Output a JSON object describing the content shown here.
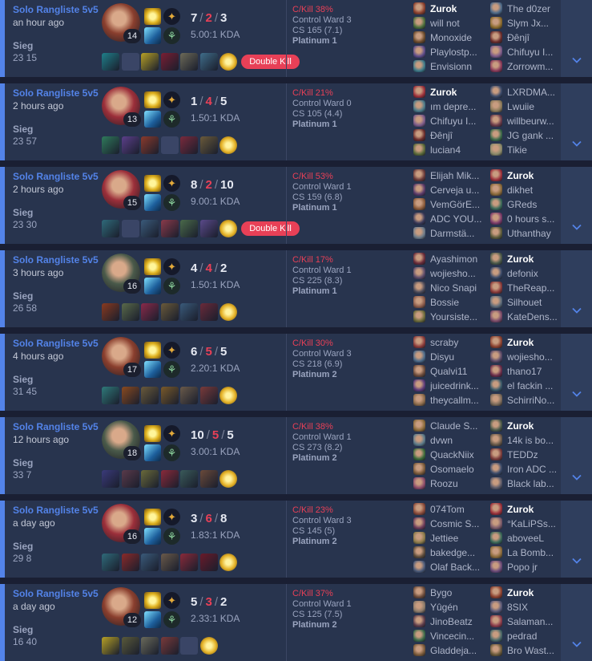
{
  "labels": {
    "double_kill": "Double Kill"
  },
  "colors": {
    "win_stripe": "#5383e8",
    "death_red": "#e84057",
    "row_bg": "#28344e"
  },
  "icons": {
    "expand": "chevron-down-icon"
  },
  "matches": [
    {
      "queue": "Solo Rangliste 5v5",
      "ago": "an hour ago",
      "result": "Sieg",
      "length": "23 15",
      "level": "14",
      "kills": "7",
      "deaths": "2",
      "assists": "3",
      "kda": "5.00:1 KDA",
      "champ_color": "#8a3f2e",
      "badge": true,
      "items": [
        "#1f7f8a",
        "",
        "#b7a126",
        "#7a1e33",
        "#6d6a58",
        "#3f6d8a",
        "gold"
      ],
      "ckill": "C/Kill 38%",
      "ward": "Control Ward 3",
      "cs": "CS 165 (7.1)",
      "tier": "Platinum 1",
      "team1": [
        {
          "name": "Zurok",
          "me": true,
          "c": "#8a3f2e"
        },
        {
          "name": "will not",
          "c": "#4a6e3c"
        },
        {
          "name": "Monoxide",
          "c": "#6a4a2c"
        },
        {
          "name": "Playlostp...",
          "c": "#5b4b8a"
        },
        {
          "name": "Envisionn",
          "c": "#3c7a8a"
        }
      ],
      "team2": [
        {
          "name": "The d0zer",
          "c": "#4d6a8a"
        },
        {
          "name": "Slym Jx...",
          "c": "#8a6a2c"
        },
        {
          "name": "Đênjî",
          "c": "#6a2c2c"
        },
        {
          "name": "Chifuyu I...",
          "c": "#7a5a8a"
        },
        {
          "name": "Zorrowm...",
          "c": "#8a3a5a"
        }
      ]
    },
    {
      "queue": "Solo Rangliste 5v5",
      "ago": "2 hours ago",
      "result": "Sieg",
      "length": "23 57",
      "level": "13",
      "kills": "1",
      "deaths": "4",
      "assists": "5",
      "kda": "1.50:1 KDA",
      "champ_color": "#9b2f3a",
      "badge": false,
      "items": [
        "#2f7a5b",
        "#5b3f8a",
        "#8a3a2c",
        "",
        "#7a2a3c",
        "#6a5a3a",
        "gold"
      ],
      "ckill": "C/Kill 21%",
      "ward": "Control Ward 0",
      "cs": "CS 105 (4.4)",
      "tier": "Platinum 1",
      "team1": [
        {
          "name": "Zurok",
          "me": true,
          "c": "#9b2f3a"
        },
        {
          "name": "ım depre...",
          "c": "#4a7a8a"
        },
        {
          "name": "Chifuyu I...",
          "c": "#7a5a8a"
        },
        {
          "name": "Đênjî",
          "c": "#6a2c2c"
        },
        {
          "name": "lucian4",
          "c": "#5a6a3a"
        }
      ],
      "team2": [
        {
          "name": "LXRDMA...",
          "c": "#3a4a6a"
        },
        {
          "name": "Lwuiie",
          "c": "#8a7a5a"
        },
        {
          "name": "willbeurw...",
          "c": "#6a3a4a"
        },
        {
          "name": "JG gank ...",
          "c": "#3a6a4a"
        },
        {
          "name": "Tikie",
          "c": "#8a8a6a"
        }
      ]
    },
    {
      "queue": "Solo Rangliste 5v5",
      "ago": "2 hours ago",
      "result": "Sieg",
      "length": "23 30",
      "level": "15",
      "kills": "8",
      "deaths": "2",
      "assists": "10",
      "kda": "9.00:1 KDA",
      "champ_color": "#9b2f3a",
      "badge": true,
      "items": [
        "#2f6a7a",
        "",
        "#3a5a7a",
        "#8a3a4a",
        "#4a6a4a",
        "#5a4a8a",
        "gold"
      ],
      "ckill": "C/Kill 53%",
      "ward": "Control Ward 1",
      "cs": "CS 159 (6.8)",
      "tier": "Platinum 1",
      "team1": [
        {
          "name": "Elijah Mik...",
          "c": "#6a3a3a"
        },
        {
          "name": "Cerveja u...",
          "c": "#5a3a6a"
        },
        {
          "name": "VemGörE...",
          "c": "#8a5a3a"
        },
        {
          "name": "ADC YOU...",
          "c": "#3a3a5a"
        },
        {
          "name": "Darmstä...",
          "c": "#6a7a8a"
        }
      ],
      "team2": [
        {
          "name": "Zurok",
          "me": true,
          "c": "#9b2f3a"
        },
        {
          "name": "dikhet",
          "c": "#8a6a3a"
        },
        {
          "name": "GReds",
          "c": "#3a6a5a"
        },
        {
          "name": "0 hours s...",
          "c": "#7a3a6a"
        },
        {
          "name": "Uthanthay",
          "c": "#5a5a3a"
        }
      ]
    },
    {
      "queue": "Solo Rangliste 5v5",
      "ago": "3 hours ago",
      "result": "Sieg",
      "length": "26 58",
      "level": "16",
      "kills": "4",
      "deaths": "4",
      "assists": "2",
      "kda": "1.50:1 KDA",
      "champ_color": "#4a5a4a",
      "badge": false,
      "items": [
        "#8a3a1f",
        "#5a6a4a",
        "#8a2a4a",
        "#6a5a3a",
        "#3a5a7a",
        "#6a2a3a",
        "gold"
      ],
      "ckill": "C/Kill 17%",
      "ward": "Control Ward 1",
      "cs": "CS 225 (8.3)",
      "tier": "Platinum 1",
      "team1": [
        {
          "name": "Ayashimon",
          "c": "#6a2c3a"
        },
        {
          "name": "wojiesho...",
          "c": "#5a4a6a"
        },
        {
          "name": "Nico Snapi",
          "c": "#4a4a5a"
        },
        {
          "name": "Bossie",
          "c": "#8a5a4a"
        },
        {
          "name": "Yoursiste...",
          "c": "#6a6a3a"
        }
      ],
      "team2": [
        {
          "name": "Zurok",
          "me": true,
          "c": "#4a5a4a"
        },
        {
          "name": "defonix",
          "c": "#3a4a6a"
        },
        {
          "name": "TheReap...",
          "c": "#8a3a3a"
        },
        {
          "name": "Silhouet",
          "c": "#5a6a7a"
        },
        {
          "name": "KateDens...",
          "c": "#7a4a6a"
        }
      ]
    },
    {
      "queue": "Solo Rangliste 5v5",
      "ago": "4 hours ago",
      "result": "Sieg",
      "length": "31 45",
      "level": "17",
      "kills": "6",
      "deaths": "5",
      "assists": "5",
      "kda": "2.20:1 KDA",
      "champ_color": "#8a3f2e",
      "badge": false,
      "items": [
        "#2f7a7a",
        "#8a4a1f",
        "#6a5a3a",
        "#7a5a2a",
        "#6a5a4a",
        "#7a3a3a",
        "gold"
      ],
      "ckill": "C/Kill 30%",
      "ward": "Control Ward 3",
      "cs": "CS 218 (6.9)",
      "tier": "Platinum 2",
      "team1": [
        {
          "name": "scraby",
          "c": "#8a3a3a"
        },
        {
          "name": "Disyu",
          "c": "#4a6a8a"
        },
        {
          "name": "Qualvi11",
          "c": "#6a4a3a"
        },
        {
          "name": "juicedrink...",
          "c": "#5a3a7a"
        },
        {
          "name": "theycallm...",
          "c": "#8a6a4a"
        }
      ],
      "team2": [
        {
          "name": "Zurok",
          "me": true,
          "c": "#8a3f2e"
        },
        {
          "name": "wojiesho...",
          "c": "#5a4a6a"
        },
        {
          "name": "thano17",
          "c": "#6a2c4a"
        },
        {
          "name": "el fackin ...",
          "c": "#3a5a6a"
        },
        {
          "name": "SchirriNo...",
          "c": "#7a6a5a"
        }
      ]
    },
    {
      "queue": "Solo Rangliste 5v5",
      "ago": "12 hours ago",
      "result": "Sieg",
      "length": "33 7",
      "level": "18",
      "kills": "10",
      "deaths": "5",
      "assists": "5",
      "kda": "3.00:1 KDA",
      "champ_color": "#4a5a4a",
      "badge": false,
      "items": [
        "#3a3a7a",
        "#5a3a4a",
        "#6a6a3a",
        "#8a2a3a",
        "#3a5a5a",
        "#6a4a3a",
        "gold"
      ],
      "ckill": "C/Kill 38%",
      "ward": "Control Ward 1",
      "cs": "CS 273 (8.2)",
      "tier": "Platinum 2",
      "team1": [
        {
          "name": "Claude S...",
          "c": "#8a6a3a"
        },
        {
          "name": "dvwn",
          "c": "#5a7a8a"
        },
        {
          "name": "QuackNiix",
          "c": "#3a6a3a"
        },
        {
          "name": "Osomaelo",
          "c": "#7a5a3a"
        },
        {
          "name": "Roozu",
          "c": "#8a4a6a"
        }
      ],
      "team2": [
        {
          "name": "Zurok",
          "me": true,
          "c": "#4a5a4a"
        },
        {
          "name": "14k is bo...",
          "c": "#6a5a4a"
        },
        {
          "name": "TEDDz",
          "c": "#7a3a3a"
        },
        {
          "name": "Iron ADC ...",
          "c": "#3a4a6a"
        },
        {
          "name": "Black lab...",
          "c": "#5a5a6a"
        }
      ]
    },
    {
      "queue": "Solo Rangliste 5v5",
      "ago": "a day ago",
      "result": "Sieg",
      "length": "29 8",
      "level": "16",
      "kills": "3",
      "deaths": "6",
      "assists": "8",
      "kda": "1.83:1 KDA",
      "champ_color": "#9b2f3a",
      "badge": false,
      "items": [
        "#2f6a7a",
        "#8a2a2a",
        "#3a5a7a",
        "#6a5a4a",
        "#8a2a3a",
        "#6a1a2a",
        "gold"
      ],
      "ckill": "C/Kill 23%",
      "ward": "Control Ward 3",
      "cs": "CS 145 (5)",
      "tier": "Platinum 2",
      "team1": [
        {
          "name": "074Tom",
          "c": "#8a4a3a"
        },
        {
          "name": "Cosmic S...",
          "c": "#6a3a5a"
        },
        {
          "name": "Jettiee",
          "c": "#8a7a4a"
        },
        {
          "name": "bakedge...",
          "c": "#5a4a3a"
        },
        {
          "name": "Olaf Back...",
          "c": "#4a5a7a"
        }
      ],
      "team2": [
        {
          "name": "Zurok",
          "me": true,
          "c": "#9b2f3a"
        },
        {
          "name": "°KaLiPSs...",
          "c": "#7a5a6a"
        },
        {
          "name": "aboveeL",
          "c": "#3a6a5a"
        },
        {
          "name": "La Bomb...",
          "c": "#8a6a3a"
        },
        {
          "name": "Popo jr",
          "c": "#6a4a7a"
        }
      ]
    },
    {
      "queue": "Solo Rangliste 5v5",
      "ago": "a day ago",
      "result": "Sieg",
      "length": "16 40",
      "level": "12",
      "kills": "5",
      "deaths": "3",
      "assists": "2",
      "kda": "2.33:1 KDA",
      "champ_color": "#8a3f2e",
      "badge": false,
      "items": [
        "#b7a126",
        "#5a5a3a",
        "#6a6a5a",
        "#7a3a3a",
        "",
        "gold"
      ],
      "ckill": "C/Kill 37%",
      "ward": "Control Ward 1",
      "cs": "CS 125 (7.5)",
      "tier": "Platinum 2",
      "team1": [
        {
          "name": "Bygo",
          "c": "#6a4a3a"
        },
        {
          "name": "Yûgén",
          "c": "#8a7a6a"
        },
        {
          "name": "JinoBeatz",
          "c": "#5a3a4a"
        },
        {
          "name": "Vincecin...",
          "c": "#3a6a4a"
        },
        {
          "name": "Gladdeja...",
          "c": "#7a5a3a"
        }
      ],
      "team2": [
        {
          "name": "Zurok",
          "me": true,
          "c": "#8a3f2e"
        },
        {
          "name": "8SIX",
          "c": "#5a5a7a"
        },
        {
          "name": "Salaman...",
          "c": "#8a3a4a"
        },
        {
          "name": "pedrad",
          "c": "#4a6a6a"
        },
        {
          "name": "Bro Wast...",
          "c": "#6a5a3a"
        }
      ]
    }
  ]
}
